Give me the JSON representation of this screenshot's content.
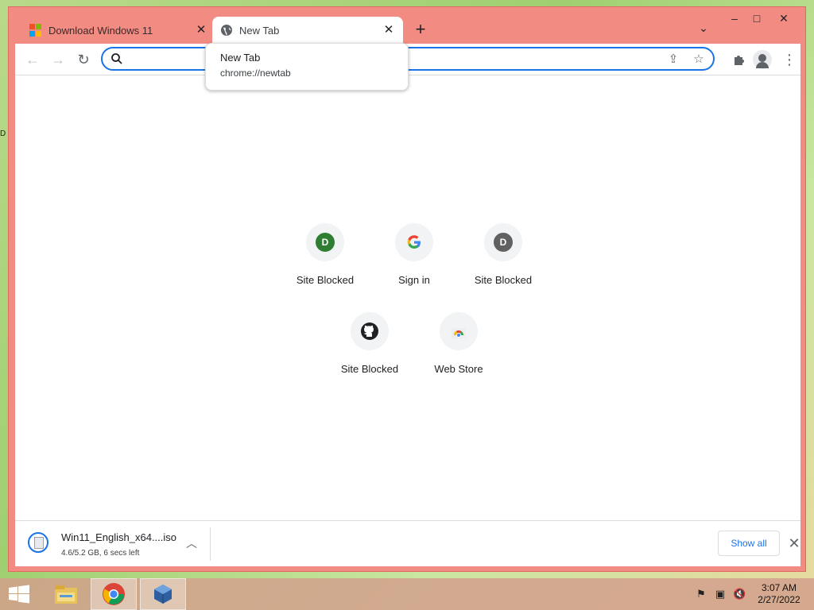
{
  "browser": {
    "tabs": [
      {
        "title": "Download Windows 11",
        "active": false
      },
      {
        "title": "New Tab",
        "active": true
      }
    ],
    "window_controls": {
      "minimize": "–",
      "maximize": "□",
      "close": "✕"
    }
  },
  "toolbar": {
    "omnibox_value": "",
    "omnibox_placeholder": ""
  },
  "tooltip": {
    "title": "New Tab",
    "url": "chrome://newtab"
  },
  "shortcuts": [
    {
      "label": "Site Blocked",
      "letter": "D",
      "color": "#2e7d32",
      "icon": "letter-D"
    },
    {
      "label": "Sign in",
      "icon": "google-g-icon"
    },
    {
      "label": "Site Blocked",
      "letter": "D",
      "color": "#616161",
      "icon": "letter-D"
    },
    {
      "label": "Site Blocked",
      "icon": "github-icon"
    },
    {
      "label": "Web Store",
      "icon": "chrome-web-store-icon"
    }
  ],
  "download": {
    "filename": "Win11_English_x64....iso",
    "status": "4.6/5.2 GB, 6 secs left",
    "show_all": "Show all"
  },
  "taskbar": {
    "time": "3:07 AM",
    "date": "2/27/2022",
    "apps": [
      "file-explorer",
      "google-chrome",
      "virtualbox"
    ]
  },
  "desktop_edge_text": "D",
  "colors": {
    "titlebar": "#f28b82",
    "accent": "#1a73e8"
  }
}
